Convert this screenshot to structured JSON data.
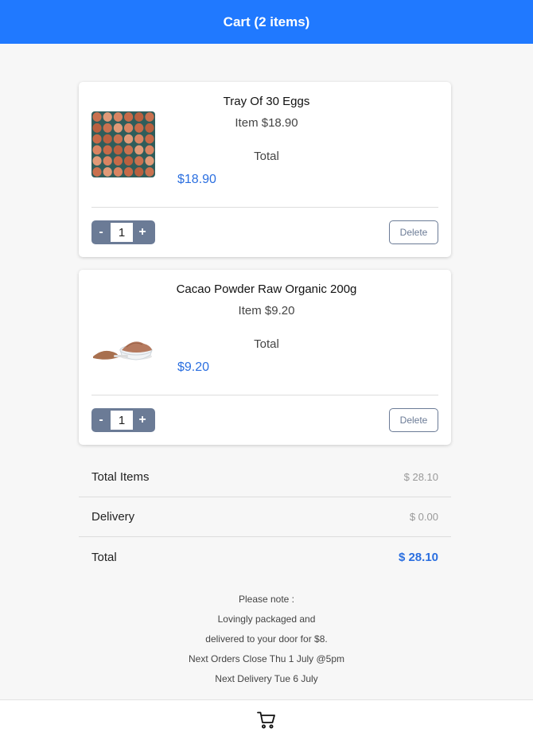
{
  "header": {
    "title": "Cart (2 items)"
  },
  "cart_items": [
    {
      "name": "Tray Of 30 Eggs",
      "item_price": "Item $18.90",
      "total_label": "Total",
      "total_value": "$18.90",
      "quantity": "1",
      "minus_label": "-",
      "plus_label": "+",
      "delete_label": "Delete",
      "image_icon": "eggs-tray-image"
    },
    {
      "name": "Cacao Powder Raw Organic 200g",
      "item_price": "Item $9.20",
      "total_label": "Total",
      "total_value": "$9.20",
      "quantity": "1",
      "minus_label": "-",
      "plus_label": "+",
      "delete_label": "Delete",
      "image_icon": "cacao-powder-image"
    }
  ],
  "summary": {
    "total_items_label": "Total Items",
    "total_items_value": "$ 28.10",
    "delivery_label": "Delivery",
    "delivery_value": "$ 0.00",
    "total_label": "Total",
    "total_value": "$ 28.10"
  },
  "notes": [
    "Please note :",
    "Lovingly packaged and",
    "delivered to your door for $8.",
    "Next Orders Close Thu 1 July @5pm",
    "Next Delivery Tue 6 July"
  ],
  "bottom_nav": {
    "icon": "cart-icon"
  },
  "colors": {
    "primary": "#2079ff",
    "accent_text": "#2b6fe0",
    "stepper": "#6b7b96"
  }
}
